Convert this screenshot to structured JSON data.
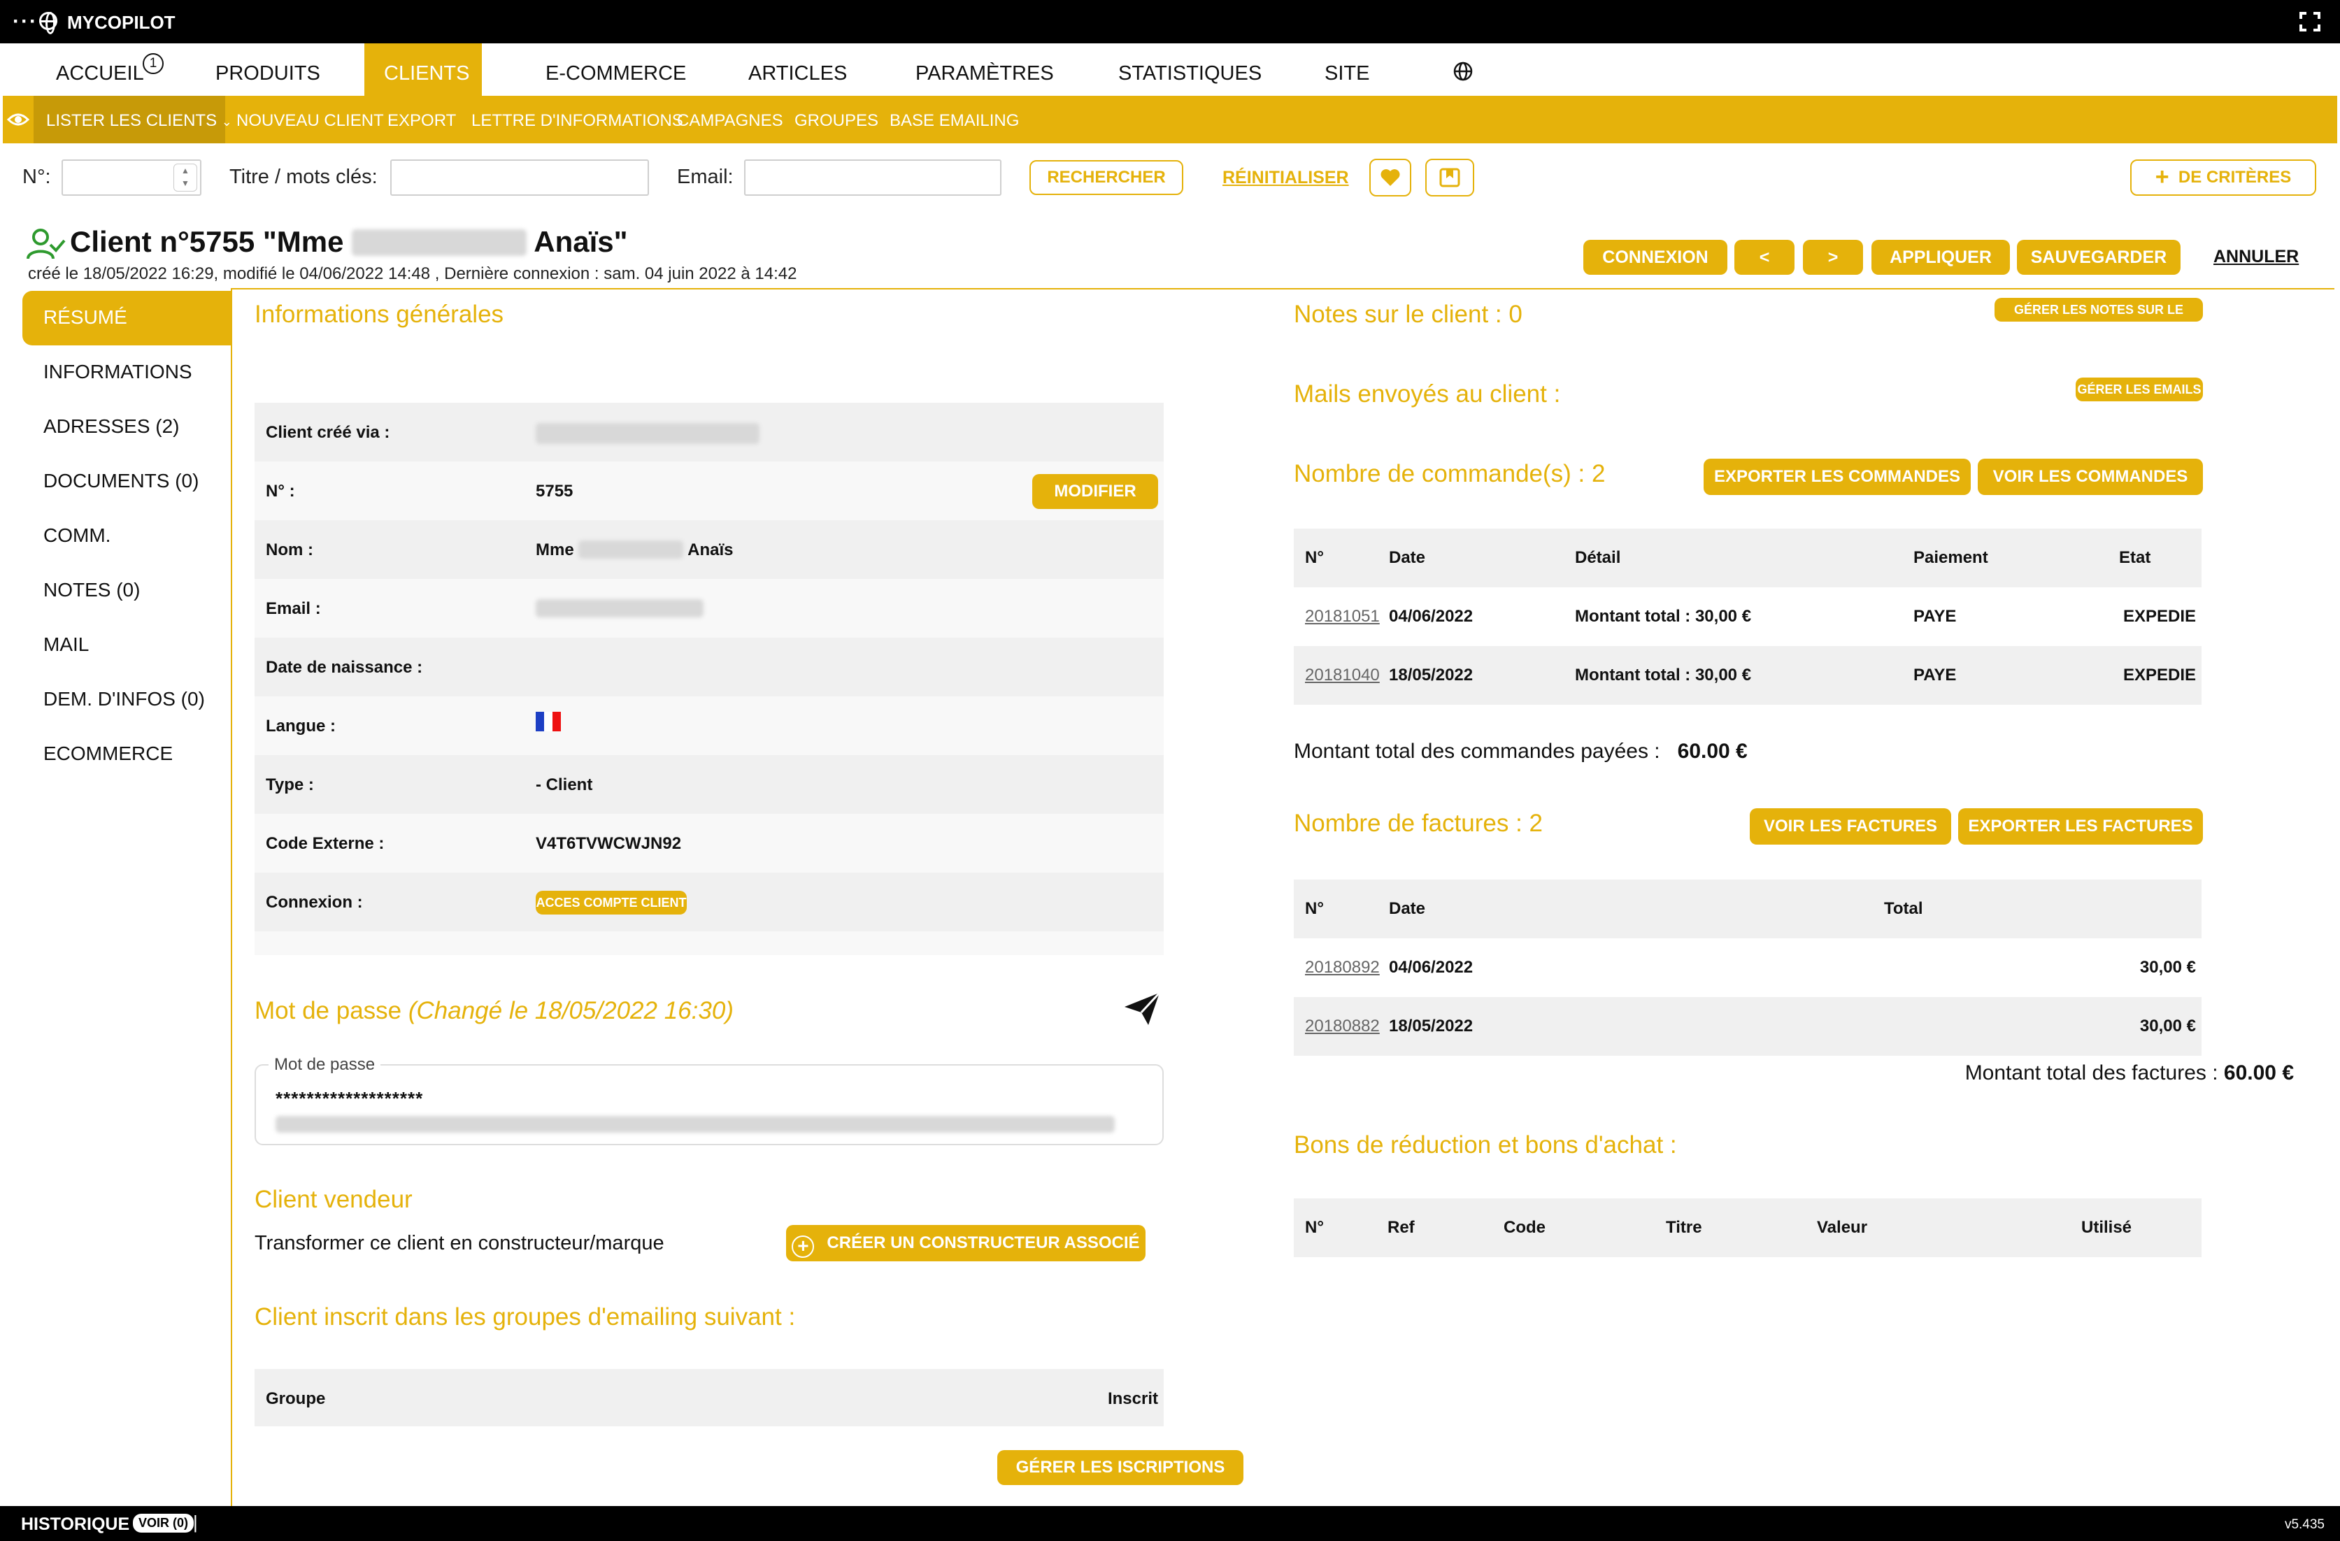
{
  "app": {
    "title": "MYCOPILOT"
  },
  "nav": {
    "items": [
      "ACCUEIL",
      "PRODUITS",
      "CLIENTS",
      "E-COMMERCE",
      "ARTICLES",
      "PARAMÈTRES",
      "STATISTIQUES",
      "SITE"
    ],
    "info_badge": "1"
  },
  "subnav": {
    "items": [
      "LISTER LES CLIENTS",
      "NOUVEAU CLIENT",
      "EXPORT",
      "LETTRE D'INFORMATIONS",
      "CAMPAGNES",
      "GROUPES",
      "BASE EMAILING"
    ]
  },
  "search": {
    "num_label": "N°:",
    "title_label": "Titre / mots clés:",
    "email_label": "Email:",
    "search_button": "RECHERCHER",
    "reset_link": "RÉINITIALISER",
    "criteria_button": "DE CRITÈRES"
  },
  "client": {
    "title_prefix": "Client n°5755 \"Mme",
    "title_suffix": "Anaïs\"",
    "subtitle": "créé le 18/05/2022 16:29, modifié le 04/06/2022 14:48 , Dernière connexion : sam. 04 juin 2022 à 14:42"
  },
  "actions": {
    "connexion": "CONNEXION",
    "prev": "<",
    "next": ">",
    "appliquer": "APPLIQUER",
    "sauvegarder": "SAUVEGARDER",
    "annuler": "ANNULER"
  },
  "sidebar": {
    "items": [
      "RÉSUMÉ",
      "INFORMATIONS",
      "ADRESSES (2)",
      "DOCUMENTS (0)",
      "COMM.",
      "NOTES (0)",
      "MAIL",
      "DEM. D'INFOS (0)",
      "ECOMMERCE"
    ]
  },
  "general": {
    "title": "Informations générales",
    "rows": {
      "created_via": {
        "label": "Client créé via :"
      },
      "number": {
        "label": "N° :",
        "value": "5755"
      },
      "name": {
        "label": "Nom :",
        "value_prefix": "Mme",
        "value_suffix": "Anaïs"
      },
      "email": {
        "label": "Email :"
      },
      "birthdate": {
        "label": "Date de naissance :"
      },
      "language": {
        "label": "Langue :"
      },
      "type": {
        "label": "Type :",
        "value": "- Client"
      },
      "external_code": {
        "label": "Code Externe :",
        "value": "V4T6TVWCWJN92"
      },
      "connection": {
        "label": "Connexion :",
        "button": "ACCES COMPTE CLIENT"
      }
    },
    "modify_button": "MODIFIER"
  },
  "password": {
    "title": "Mot de passe",
    "changed": "(Changé le 18/05/2022 16:30)",
    "field_label": "Mot de passe",
    "masked": "*******************"
  },
  "vendor": {
    "title": "Client vendeur",
    "text": "Transformer ce client en constructeur/marque",
    "button": "CRÉER UN CONSTRUCTEUR ASSOCIÉ"
  },
  "emailing": {
    "title": "Client inscrit dans les groupes d'emailing suivant :",
    "col_group": "Groupe",
    "col_subscribed": "Inscrit",
    "button": "GÉRER LES ISCRIPTIONS"
  },
  "notes": {
    "title": "Notes sur le client : 0",
    "button": "GÉRER LES NOTES SUR LE CLIENT"
  },
  "mails": {
    "title": "Mails envoyés au client :",
    "button": "GÉRER LES EMAILS"
  },
  "orders": {
    "title": "Nombre de commande(s) : 2",
    "export_button": "EXPORTER LES COMMANDES",
    "view_button": "VOIR LES COMMANDES",
    "headers": [
      "N°",
      "Date",
      "Détail",
      "Paiement",
      "Etat"
    ],
    "rows": [
      [
        "20181051",
        "04/06/2022",
        "Montant total : 30,00 €",
        "PAYE",
        "EXPEDIE"
      ],
      [
        "20181040",
        "18/05/2022",
        "Montant total : 30,00 €",
        "PAYE",
        "EXPEDIE"
      ]
    ],
    "total_label": "Montant total des commandes payées :",
    "total_value": "60.00 €"
  },
  "invoices": {
    "title": "Nombre de factures : 2",
    "view_button": "VOIR LES FACTURES",
    "export_button": "EXPORTER LES FACTURES",
    "headers": [
      "N°",
      "Date",
      "Total"
    ],
    "rows": [
      [
        "20180892",
        "04/06/2022",
        "30,00 €"
      ],
      [
        "20180882",
        "18/05/2022",
        "30,00 €"
      ]
    ],
    "total_label": "Montant total des factures :",
    "total_value": "60.00 €"
  },
  "vouchers": {
    "title": "Bons de réduction et bons d'achat :",
    "headers": [
      "N°",
      "Ref",
      "Code",
      "Titre",
      "Valeur",
      "Utilisé"
    ]
  },
  "footer": {
    "history": "HISTORIQUE",
    "voir": "VOIR (0)",
    "pipe": "|",
    "version": "v5.435"
  },
  "colors": {
    "accent": "#e5b20b",
    "accent_dark": "#c79a08",
    "bar": "#000000"
  }
}
